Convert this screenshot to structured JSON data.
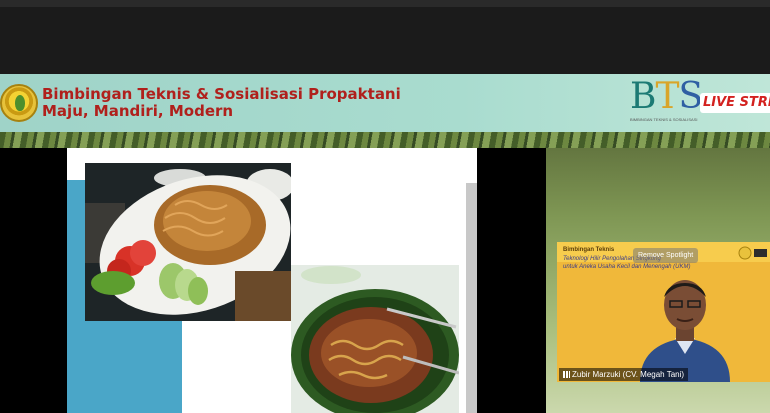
{
  "banner": {
    "title_line1": "Bimbingan Teknis & Sosialisasi Propaktani",
    "title_line2": "Maju, Mandiri, Modern",
    "brand_letters": [
      "B",
      "T",
      "S"
    ],
    "brand_caption": "BIMBINGAN TEKNIS & SOSIALISASI",
    "live_label": "LIVE STRE"
  },
  "webcam": {
    "slide_title": "Bimbingan Teknis",
    "slide_subtitle": "Teknologi Hilir Pengolahan Singkong",
    "slide_subtitle2": "untuk Aneka Usaha Kecil dan Menengah (UKM)",
    "spotlight_label": "Remove Spotlight",
    "participant_name": "Zubir Marzuki  (CV. Megah Tani)"
  },
  "colors": {
    "banner_text": "#b0201c",
    "slide_accent": "#4aa6c8",
    "webcam_bg": "#f0b83a"
  },
  "icons": {
    "logo": "ministry-emblem-icon",
    "signal": "signal-bars-icon"
  }
}
